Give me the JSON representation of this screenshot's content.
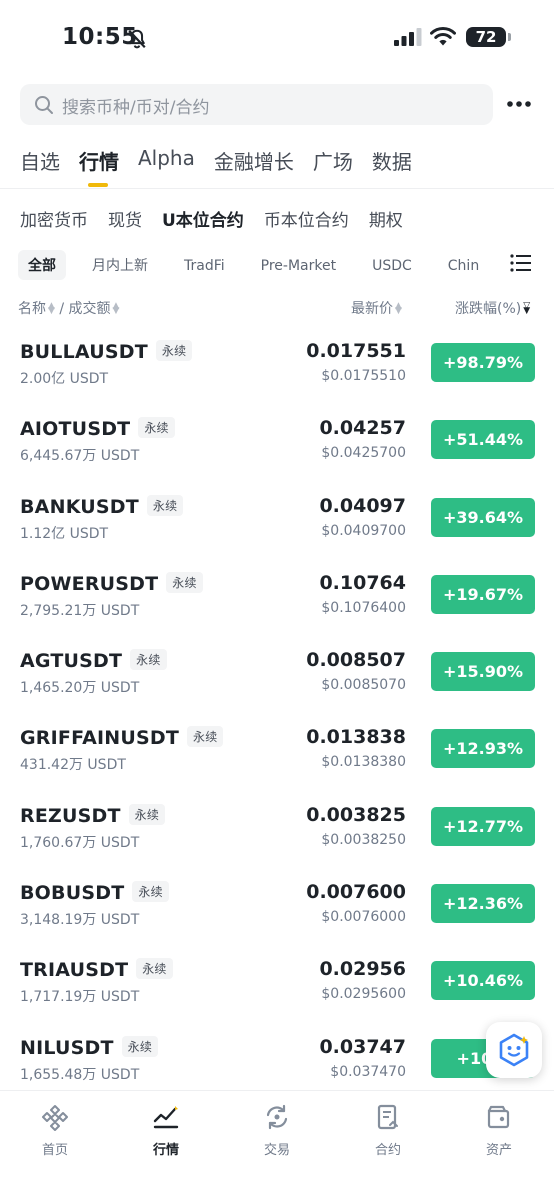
{
  "status_bar": {
    "time": "10:55",
    "battery": "72"
  },
  "search": {
    "placeholder": "搜索币种/币对/合约"
  },
  "main_tabs": [
    "自选",
    "行情",
    "Alpha",
    "金融增长",
    "广场",
    "数据"
  ],
  "sub_tabs": [
    "加密货币",
    "现货",
    "U本位合约",
    "币本位合约",
    "期权"
  ],
  "chips": [
    "全部",
    "月内上新",
    "TradFi",
    "Pre-Market",
    "USDC",
    "Chin"
  ],
  "columns": {
    "name": "名称",
    "separator": "/",
    "volume": "成交额",
    "price": "最新价",
    "change": "涨跌幅(%)"
  },
  "perp_tag": "永续",
  "rows": [
    {
      "symbol": "BULLAUSDT",
      "volume": "2.00亿 USDT",
      "price": "0.017551",
      "usd": "$0.0175510",
      "change": "+98.79%"
    },
    {
      "symbol": "AIOTUSDT",
      "volume": "6,445.67万 USDT",
      "price": "0.04257",
      "usd": "$0.0425700",
      "change": "+51.44%"
    },
    {
      "symbol": "BANKUSDT",
      "volume": "1.12亿 USDT",
      "price": "0.04097",
      "usd": "$0.0409700",
      "change": "+39.64%"
    },
    {
      "symbol": "POWERUSDT",
      "volume": "2,795.21万 USDT",
      "price": "0.10764",
      "usd": "$0.1076400",
      "change": "+19.67%"
    },
    {
      "symbol": "AGTUSDT",
      "volume": "1,465.20万 USDT",
      "price": "0.008507",
      "usd": "$0.0085070",
      "change": "+15.90%"
    },
    {
      "symbol": "GRIFFAINUSDT",
      "volume": "431.42万 USDT",
      "price": "0.013838",
      "usd": "$0.0138380",
      "change": "+12.93%"
    },
    {
      "symbol": "REZUSDT",
      "volume": "1,760.67万 USDT",
      "price": "0.003825",
      "usd": "$0.0038250",
      "change": "+12.77%"
    },
    {
      "symbol": "BOBUSDT",
      "volume": "3,148.19万 USDT",
      "price": "0.007600",
      "usd": "$0.0076000",
      "change": "+12.36%"
    },
    {
      "symbol": "TRIAUSDT",
      "volume": "1,717.19万 USDT",
      "price": "0.02956",
      "usd": "$0.0295600",
      "change": "+10.46%"
    },
    {
      "symbol": "NILUSDT",
      "volume": "1,655.48万 USDT",
      "price": "0.03747",
      "usd": "$0.037470",
      "change": "+10.6"
    }
  ],
  "bottom_nav": [
    "首页",
    "行情",
    "交易",
    "合约",
    "资产"
  ],
  "colors": {
    "accent": "#f0b90b",
    "up": "#2ebd85"
  }
}
